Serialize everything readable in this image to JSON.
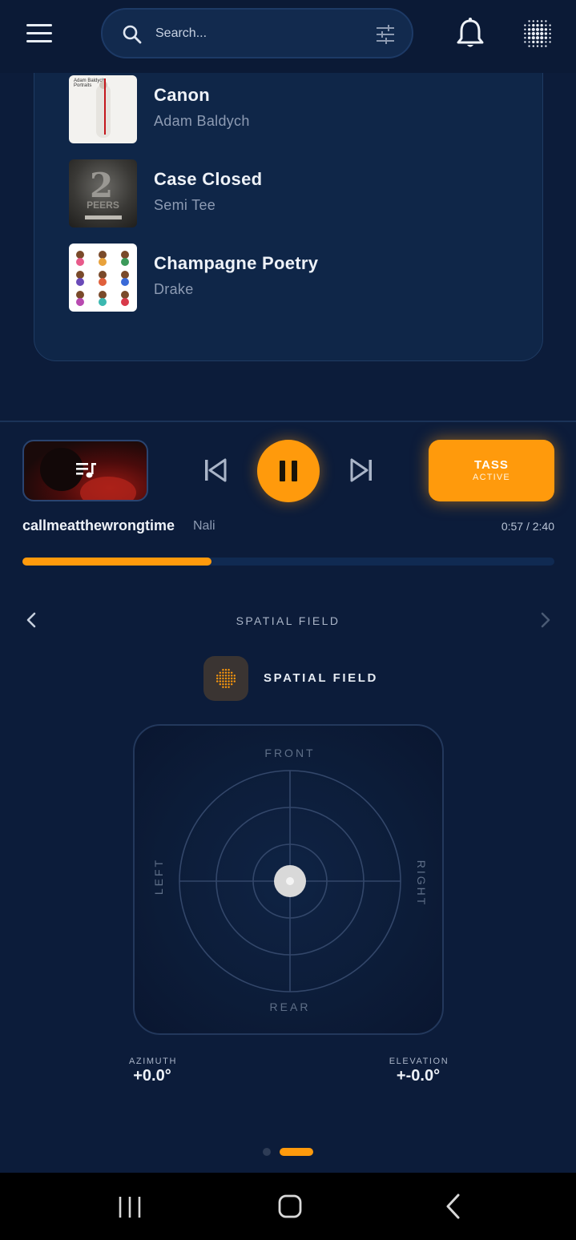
{
  "header": {
    "search_placeholder": "Search..."
  },
  "tracks": [
    {
      "title": "Canon",
      "artist": "Adam Baldych",
      "art_caption": "Adam Baldych\nPortraits"
    },
    {
      "title": "Case Closed",
      "artist": "Semi Tee",
      "art_caption": "PEERS"
    },
    {
      "title": "Champagne Poetry",
      "artist": "Drake"
    }
  ],
  "now_playing": {
    "title": "callmeatthewrongtime",
    "artist": "Nali",
    "time": "0:57 / 2:40",
    "progress": 0.356
  },
  "tass": {
    "label": "TASS",
    "status": "ACTIVE"
  },
  "section": {
    "title": "SPATIAL FIELD",
    "heading": "SPATIAL FIELD"
  },
  "spatial_pad": {
    "front": "FRONT",
    "rear": "REAR",
    "left": "LEFT",
    "right": "RIGHT"
  },
  "readouts": {
    "azimuth_label": "AZIMUTH",
    "azimuth_value": "+0.0°",
    "elevation_label": "ELEVATION",
    "elevation_value": "+-0.0°"
  },
  "pager": {
    "pages": 2,
    "active": 1
  },
  "colors": {
    "accent": "#ff9a0c",
    "background": "#0c1c3a",
    "card": "#0f2648"
  }
}
